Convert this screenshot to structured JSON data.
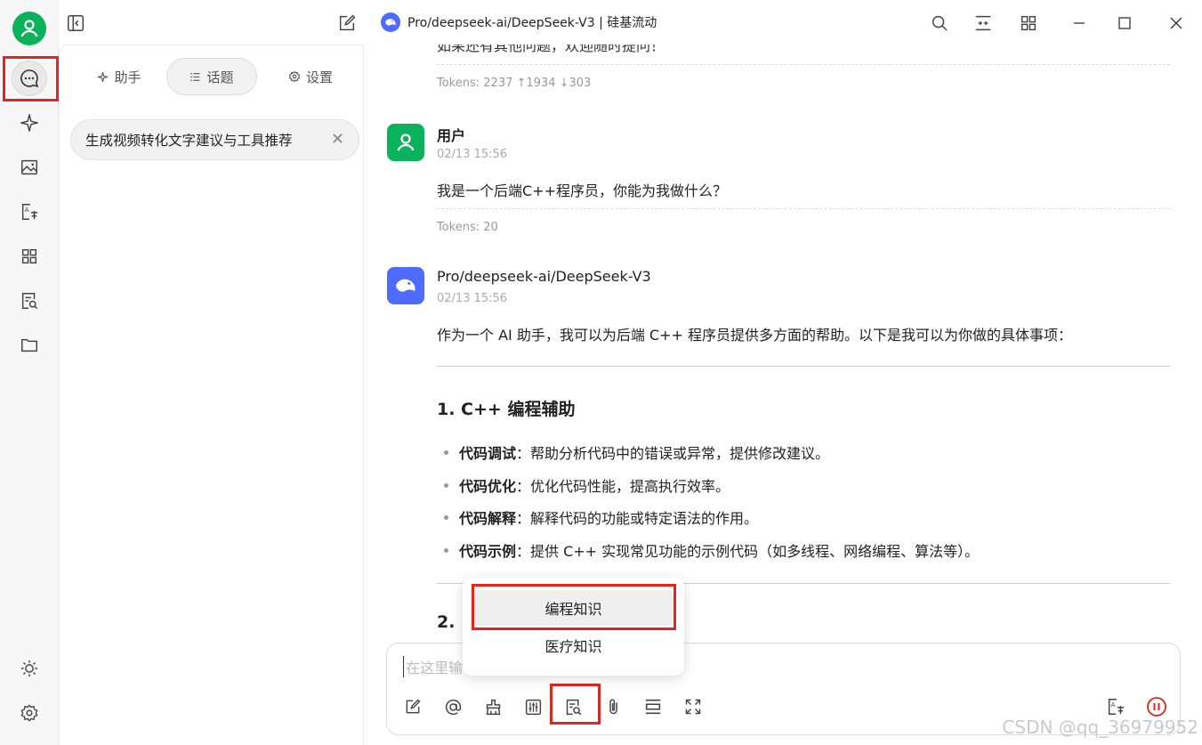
{
  "titlebar": {
    "title": "Pro/deepseek-ai/DeepSeek-V3 | 硅基流动"
  },
  "panel": {
    "tabs": [
      {
        "label": "助手",
        "icon": "sparkle-icon"
      },
      {
        "label": "话题",
        "icon": "list-icon"
      },
      {
        "label": "设置",
        "icon": "gear-icon"
      }
    ],
    "topic": "生成视频转化文字建议与工具推荐"
  },
  "chat": {
    "top_cut_text": "如果还有其他问题，欢迎随时提问！",
    "top_tokens": "Tokens: 2237 ↑1934 ↓303",
    "user": {
      "name": "用户",
      "time": "02/13 15:56",
      "text": "我是一个后端C++程序员，你能为我做什么？",
      "tokens": "Tokens: 20"
    },
    "assistant": {
      "name": "Pro/deepseek-ai/DeepSeek-V3",
      "time": "02/13 15:56",
      "intro": "作为一个 AI 助手，我可以为后端 C++ 程序员提供多方面的帮助。以下是我可以为你做的具体事项：",
      "heading1": "1. C++ 编程辅助",
      "items": [
        {
          "term": "代码调试",
          "text": "：帮助分析代码中的错误或异常，提供修改建议。"
        },
        {
          "term": "代码优化",
          "text": "：优化代码性能，提高执行效率。"
        },
        {
          "term": "代码解释",
          "text": "：解释代码的功能或特定语法的作用。"
        },
        {
          "term": "代码示例",
          "text": "：提供 C++ 实现常见功能的示例代码（如多线程、网络编程、算法等）。"
        }
      ],
      "heading2_partial": "2. "
    }
  },
  "input": {
    "placeholder": "在这里输"
  },
  "popup": {
    "items": [
      "编程知识",
      "医疗知识"
    ]
  },
  "watermark": "CSDN @qq_36979952",
  "colors": {
    "accent_green": "#0ab35b",
    "deepseek_blue": "#4d6bfe",
    "highlight_red": "#e0261f"
  }
}
